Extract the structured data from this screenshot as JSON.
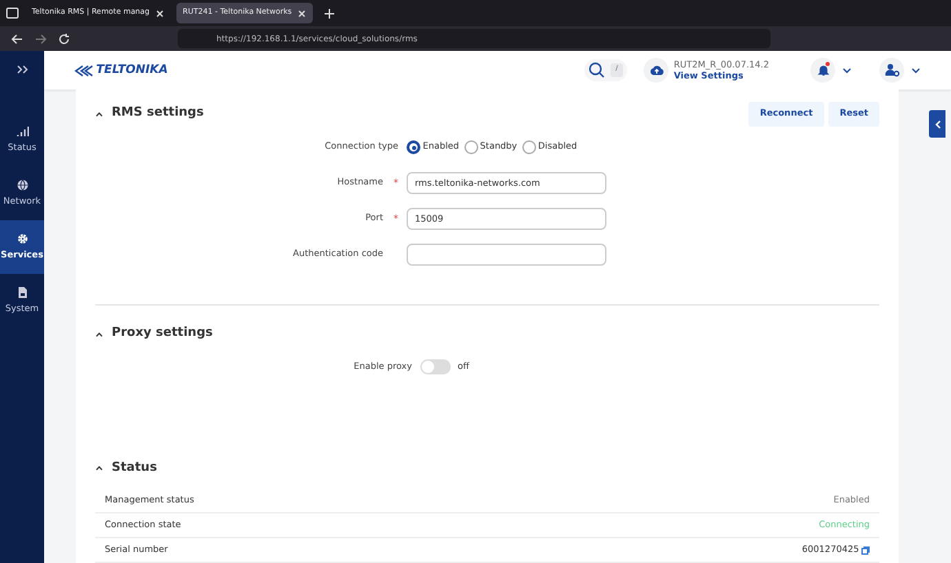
{
  "browser": {
    "tabs": [
      {
        "title": "Teltonika RMS | Remote manag",
        "selected": false
      },
      {
        "title": "RUT241 - Teltonika Networks",
        "selected": true
      }
    ],
    "url": "https://192.168.1.1/services/cloud_solutions/rms"
  },
  "sidebar": {
    "items": [
      {
        "label": "Status",
        "kind": "signal",
        "selected": false
      },
      {
        "label": "Network",
        "kind": "globe",
        "selected": false
      },
      {
        "label": "Services",
        "kind": "gear",
        "selected": true
      },
      {
        "label": "System",
        "kind": "file",
        "selected": false
      }
    ]
  },
  "header": {
    "logo": "TELTONIKA",
    "search_key": "/",
    "firmware": "RUT2M_R_00.07.14.2",
    "view_settings": "View Settings",
    "notification_unread": true
  },
  "rms_settings": {
    "title": "RMS settings",
    "buttons": [
      "Reconnect",
      "Reset"
    ],
    "connection_type": {
      "label": "Connection type",
      "options": [
        {
          "label": "Enabled",
          "selected": true
        },
        {
          "label": "Standby",
          "selected": false
        },
        {
          "label": "Disabled",
          "selected": false
        }
      ]
    },
    "fields": [
      {
        "label": "Hostname",
        "required_mark": "*",
        "value": "rms.teltonika-networks.com"
      },
      {
        "label": "Port",
        "required_mark": "*",
        "value": "15009"
      },
      {
        "label": "Authentication code"
      }
    ]
  },
  "proxy_settings": {
    "title": "Proxy settings",
    "label": "Enable proxy",
    "on": false,
    "state_text": "off"
  },
  "status": {
    "title": "Status",
    "rows": [
      {
        "label": "Management status",
        "value": "Enabled",
        "kind": "plain"
      },
      {
        "label": "Connection state",
        "value": "Connecting",
        "kind": "success"
      },
      {
        "label": "Serial number",
        "value": "6001270425",
        "kind": "copy"
      }
    ]
  }
}
